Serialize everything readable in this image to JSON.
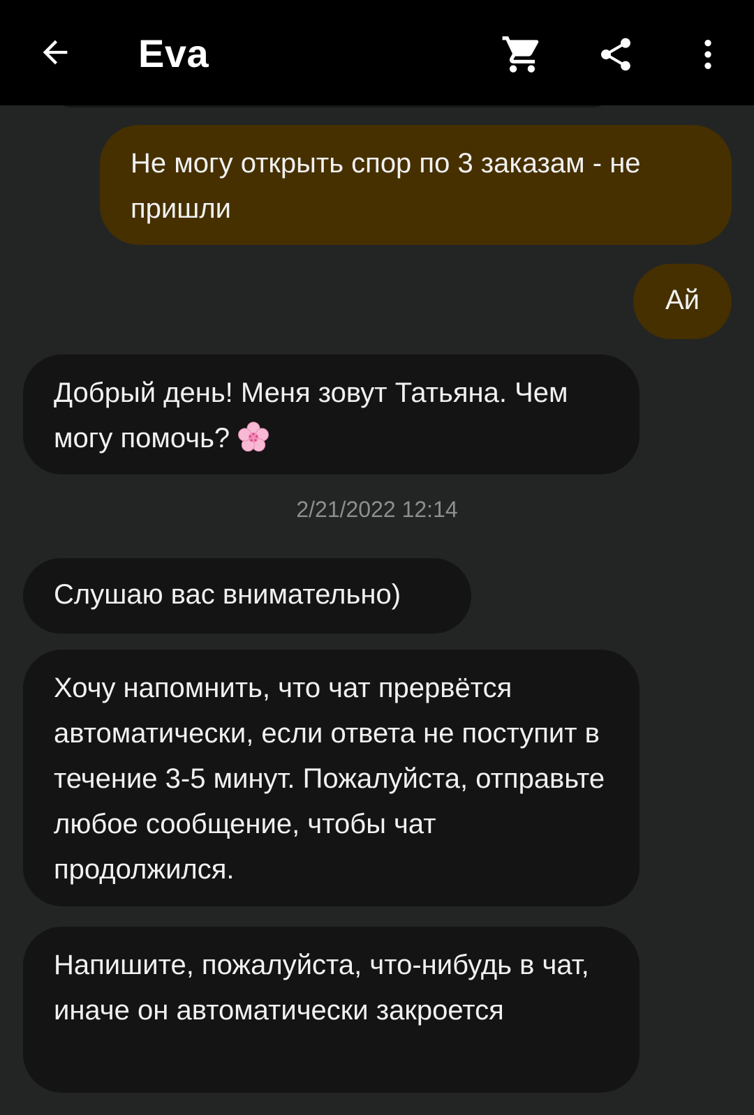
{
  "header": {
    "title": "Eva",
    "back_icon": "arrow-left-icon",
    "actions": [
      {
        "icon": "cart-icon"
      },
      {
        "icon": "share-icon"
      },
      {
        "icon": "more-vertical-icon"
      }
    ],
    "background": "#000000"
  },
  "colors": {
    "chat_background": "#232424",
    "outgoing_bubble": "#463000",
    "incoming_bubble": "#141414",
    "message_text": "#f1f1f1",
    "timestamp_text": "#8e8e8e"
  },
  "messages": [
    {
      "direction": "outgoing",
      "text": "Не могу открыть спор по 3 заказам - не пришли"
    },
    {
      "direction": "outgoing",
      "text": "Ай"
    },
    {
      "direction": "incoming",
      "text": "Добрый день! Меня зовут Татьяна. Чем могу помочь?",
      "emoji": "cherry-blossom-icon"
    },
    {
      "direction": "incoming",
      "text": "Слушаю вас внимательно)"
    },
    {
      "direction": "incoming",
      "text": "Хочу напомнить, что чат прервётся автоматически, если ответа не поступит в течение 3-5 минут. Пожалуйста, отправьте любое сообщение, чтобы чат продолжился."
    },
    {
      "direction": "incoming",
      "text": "Напишите, пожалуйста, что-нибудь в чат, иначе он автоматически закроется"
    }
  ],
  "timestamp": "2/21/2022 12:14"
}
